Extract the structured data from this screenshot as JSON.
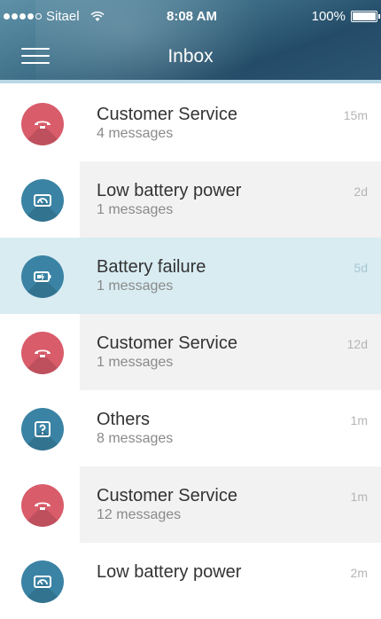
{
  "status_bar": {
    "carrier": "Sitael",
    "time": "8:08 AM",
    "battery": "100%"
  },
  "header": {
    "title": "Inbox"
  },
  "colors": {
    "header": "#3e6f88",
    "red_avatar": "#d95c6a",
    "blue_avatar": "#3a83a4",
    "selected_row": "#d8ecf2",
    "alt_row": "#f2f2f2"
  },
  "messages": [
    {
      "title": "Customer Service",
      "subtitle": "4 messages",
      "time": "15m",
      "icon": "handset-icon",
      "color": "red"
    },
    {
      "title": "Low battery power",
      "subtitle": "1 messages",
      "time": "2d",
      "icon": "low-battery-gauge-icon",
      "color": "blue"
    },
    {
      "title": "Battery failure",
      "subtitle": "1 messages",
      "time": "5d",
      "icon": "battery-icon",
      "color": "blue"
    },
    {
      "title": "Customer Service",
      "subtitle": "1 messages",
      "time": "12d",
      "icon": "handset-icon",
      "color": "red"
    },
    {
      "title": "Others",
      "subtitle": "8 messages",
      "time": "1m",
      "icon": "question-icon",
      "color": "blue"
    },
    {
      "title": "Customer Service",
      "subtitle": "12 messages",
      "time": "1m",
      "icon": "handset-icon",
      "color": "red"
    },
    {
      "title": "Low battery power",
      "subtitle": "",
      "time": "2m",
      "icon": "low-battery-gauge-icon",
      "color": "blue"
    }
  ]
}
